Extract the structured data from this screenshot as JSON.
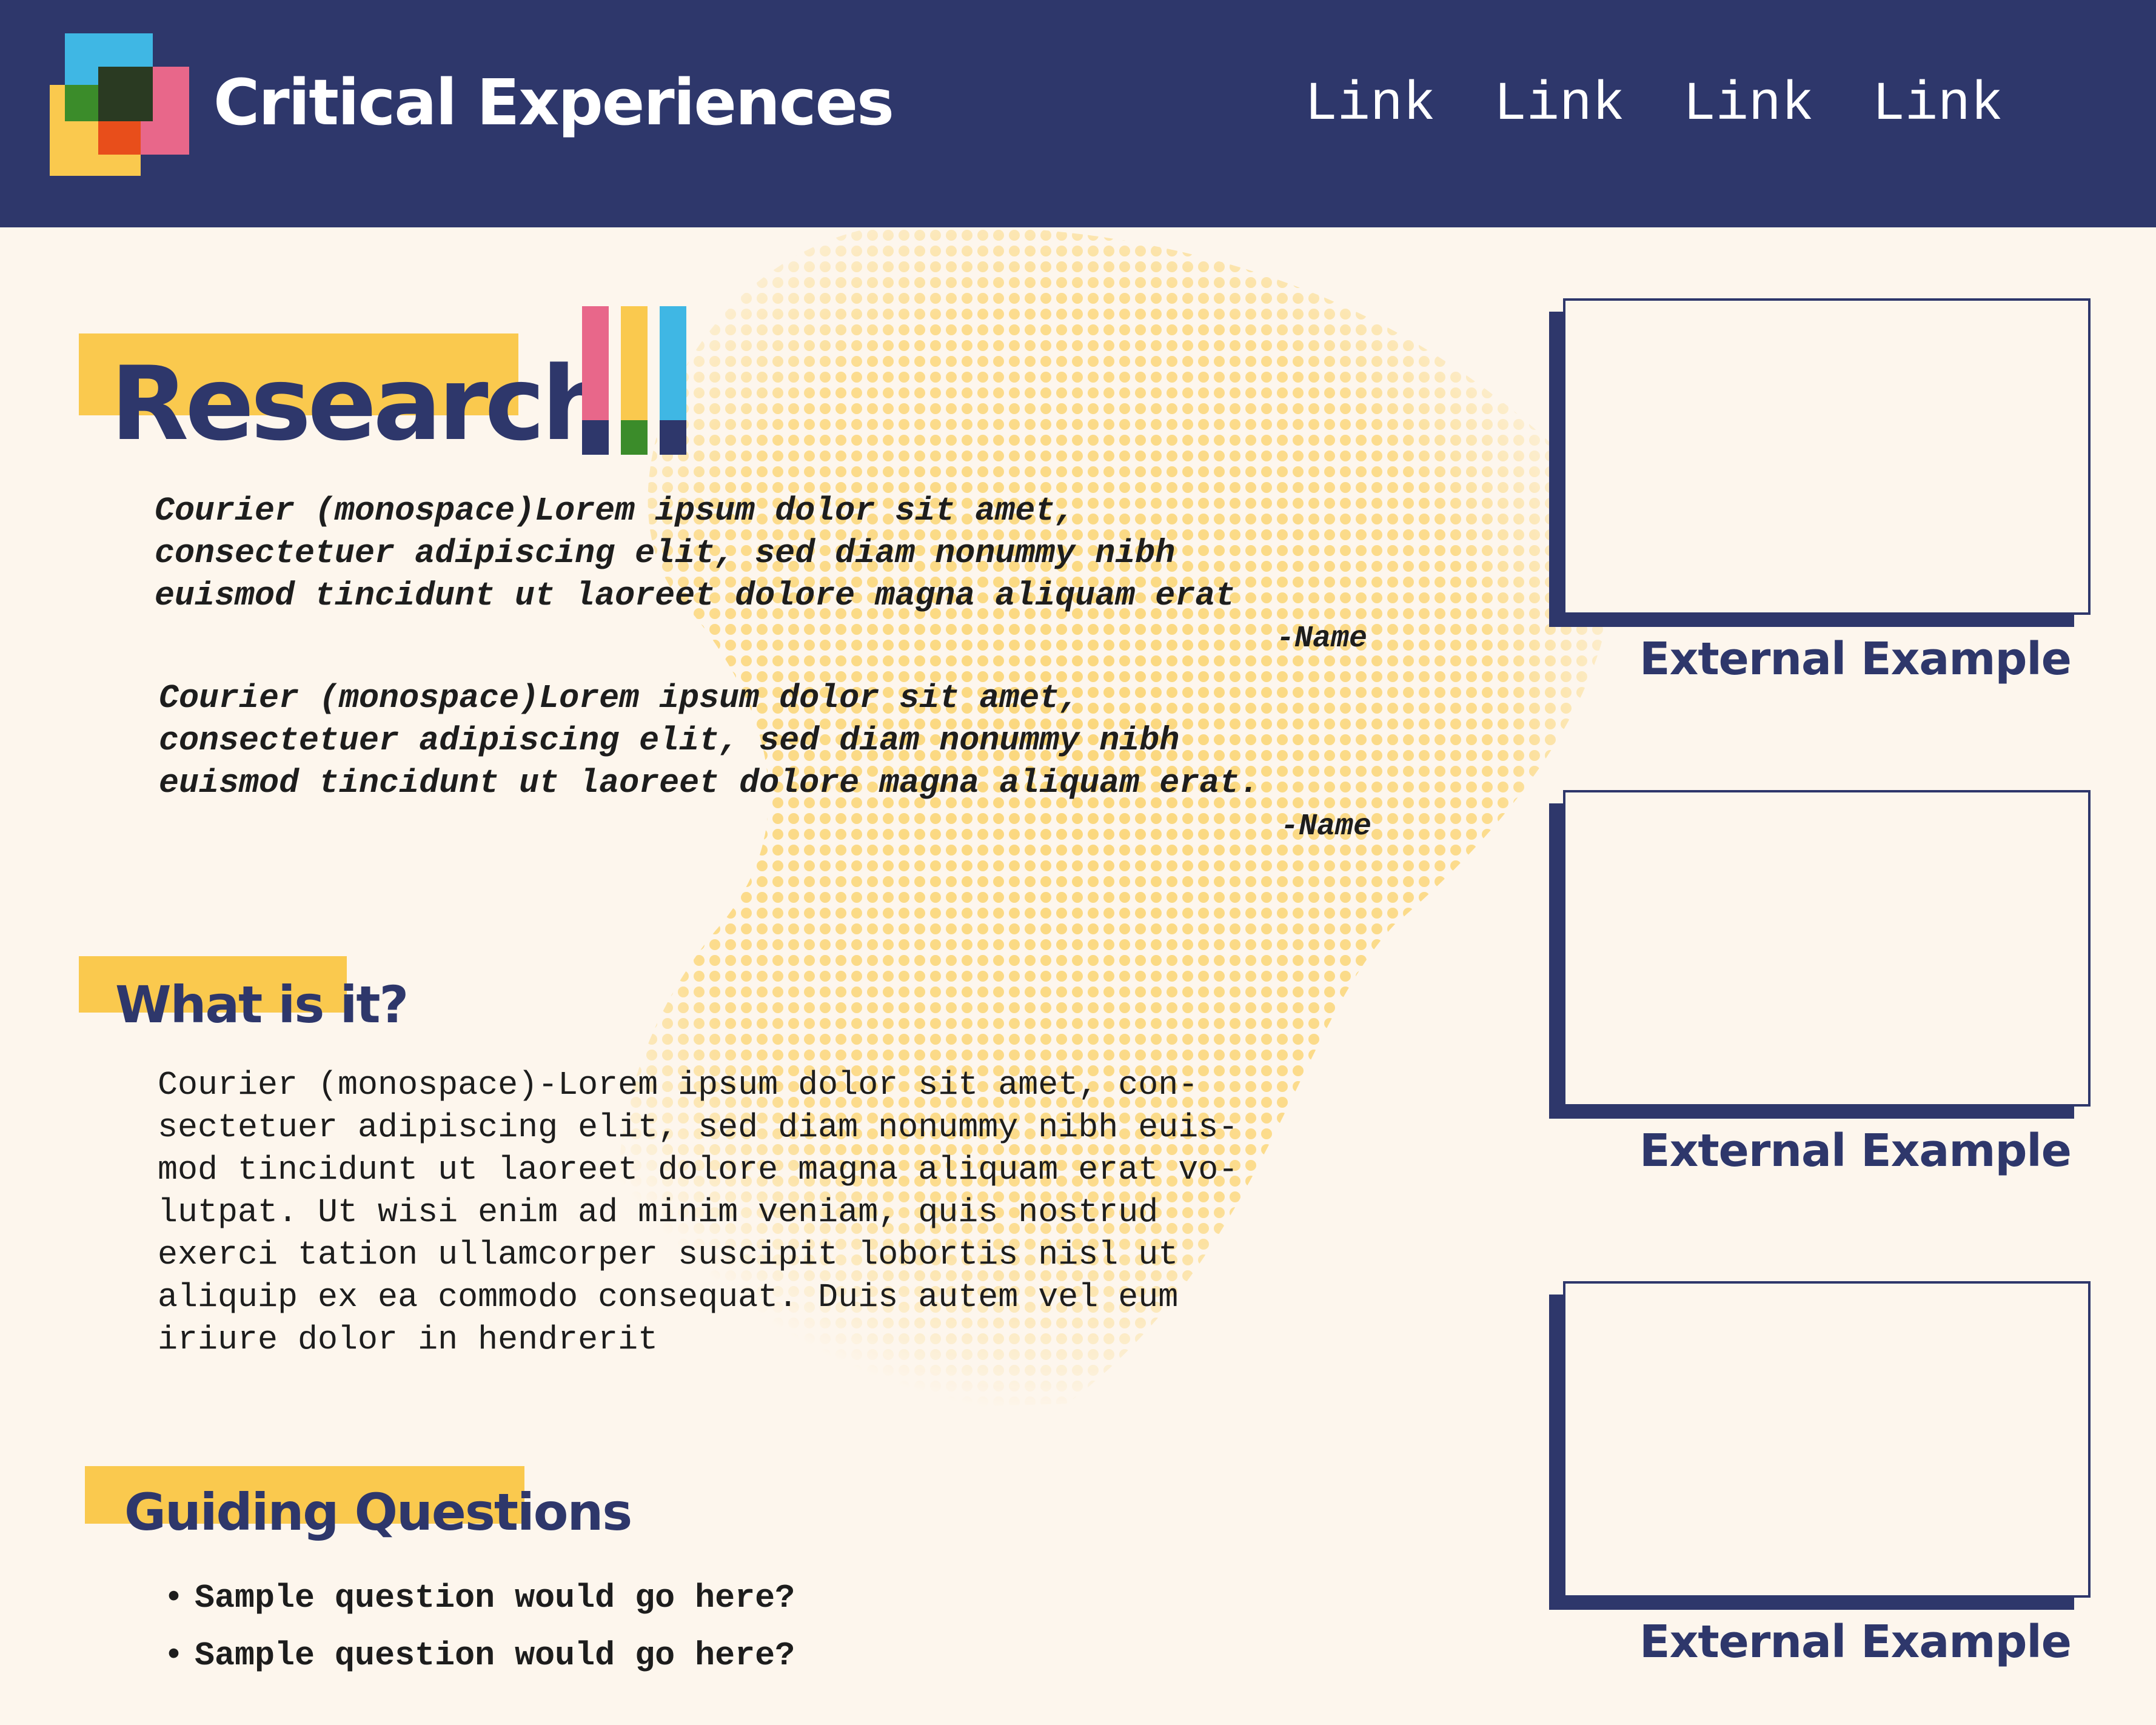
{
  "header": {
    "site_title": "Critical Experiences",
    "nav_links": [
      "Link",
      "Link",
      "Link",
      "Link"
    ]
  },
  "research": {
    "heading": "Research",
    "quotes": [
      {
        "text": "Courier (monospace)Lorem ipsum dolor sit amet,\nconsectetuer adipiscing elit, sed diam nonummy nibh\neuismod tincidunt ut laoreet dolore magna aliquam erat",
        "attribution": "-Name"
      },
      {
        "text": "Courier (monospace)Lorem ipsum dolor sit amet,\nconsectetuer adipiscing elit, sed diam nonummy nibh\neuismod tincidunt ut laoreet dolore magna aliquam erat.",
        "attribution": "-Name"
      }
    ]
  },
  "what_is_it": {
    "heading": "What is it?",
    "body": "Courier (monospace)-Lorem ipsum dolor sit amet, con-\nsectetuer adipiscing elit, sed diam nonummy nibh euis-\nmod tincidunt ut laoreet dolore magna aliquam erat vo-\nlutpat. Ut wisi enim ad minim veniam, quis nostrud\nexerci tation ullamcorper suscipit lobortis nisl ut\naliquip ex ea commodo consequat. Duis autem vel eum\niriure dolor in hendrerit"
  },
  "guiding_questions": {
    "heading": "Guiding Questions",
    "bullet": "•",
    "items": [
      "Sample question would go here?",
      "Sample question would go here?"
    ]
  },
  "examples": [
    {
      "caption": "External Example"
    },
    {
      "caption": "External Example"
    },
    {
      "caption": "External Example"
    }
  ],
  "colors": {
    "navy": "#2e376b",
    "cream": "#fdf6ed",
    "yellow": "#fac94e",
    "pink": "#e8678a",
    "blue": "#3fb7e4",
    "green": "#3b8c2a",
    "orange": "#e84e1b"
  },
  "icons": [
    "logo-squares-icon",
    "color-bars-icon",
    "halftone-pattern"
  ]
}
